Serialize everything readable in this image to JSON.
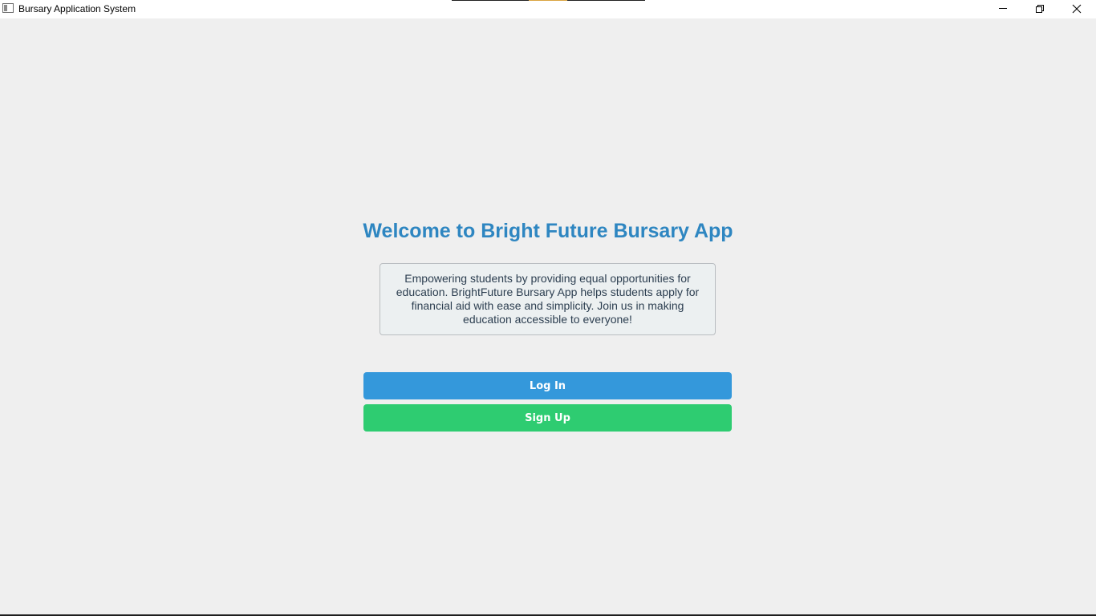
{
  "window": {
    "title": "Bursary Application System",
    "controls": [
      "minimize-icon",
      "restore-icon",
      "close-icon"
    ]
  },
  "main": {
    "heading": "Welcome to Bright Future Bursary App",
    "description": "Empowering students by providing equal opportunities for education. BrightFuture Bursary App helps students apply for financial aid with ease and simplicity. Join us in making education accessible to everyone!",
    "login_label": "Log In",
    "signup_label": "Sign Up"
  },
  "colors": {
    "background": "#efefef",
    "heading": "#2e86c1",
    "description_bg": "#ecf0f1",
    "description_text": "#2c3e50",
    "login_button": "#3498db",
    "signup_button": "#2ecc71"
  }
}
